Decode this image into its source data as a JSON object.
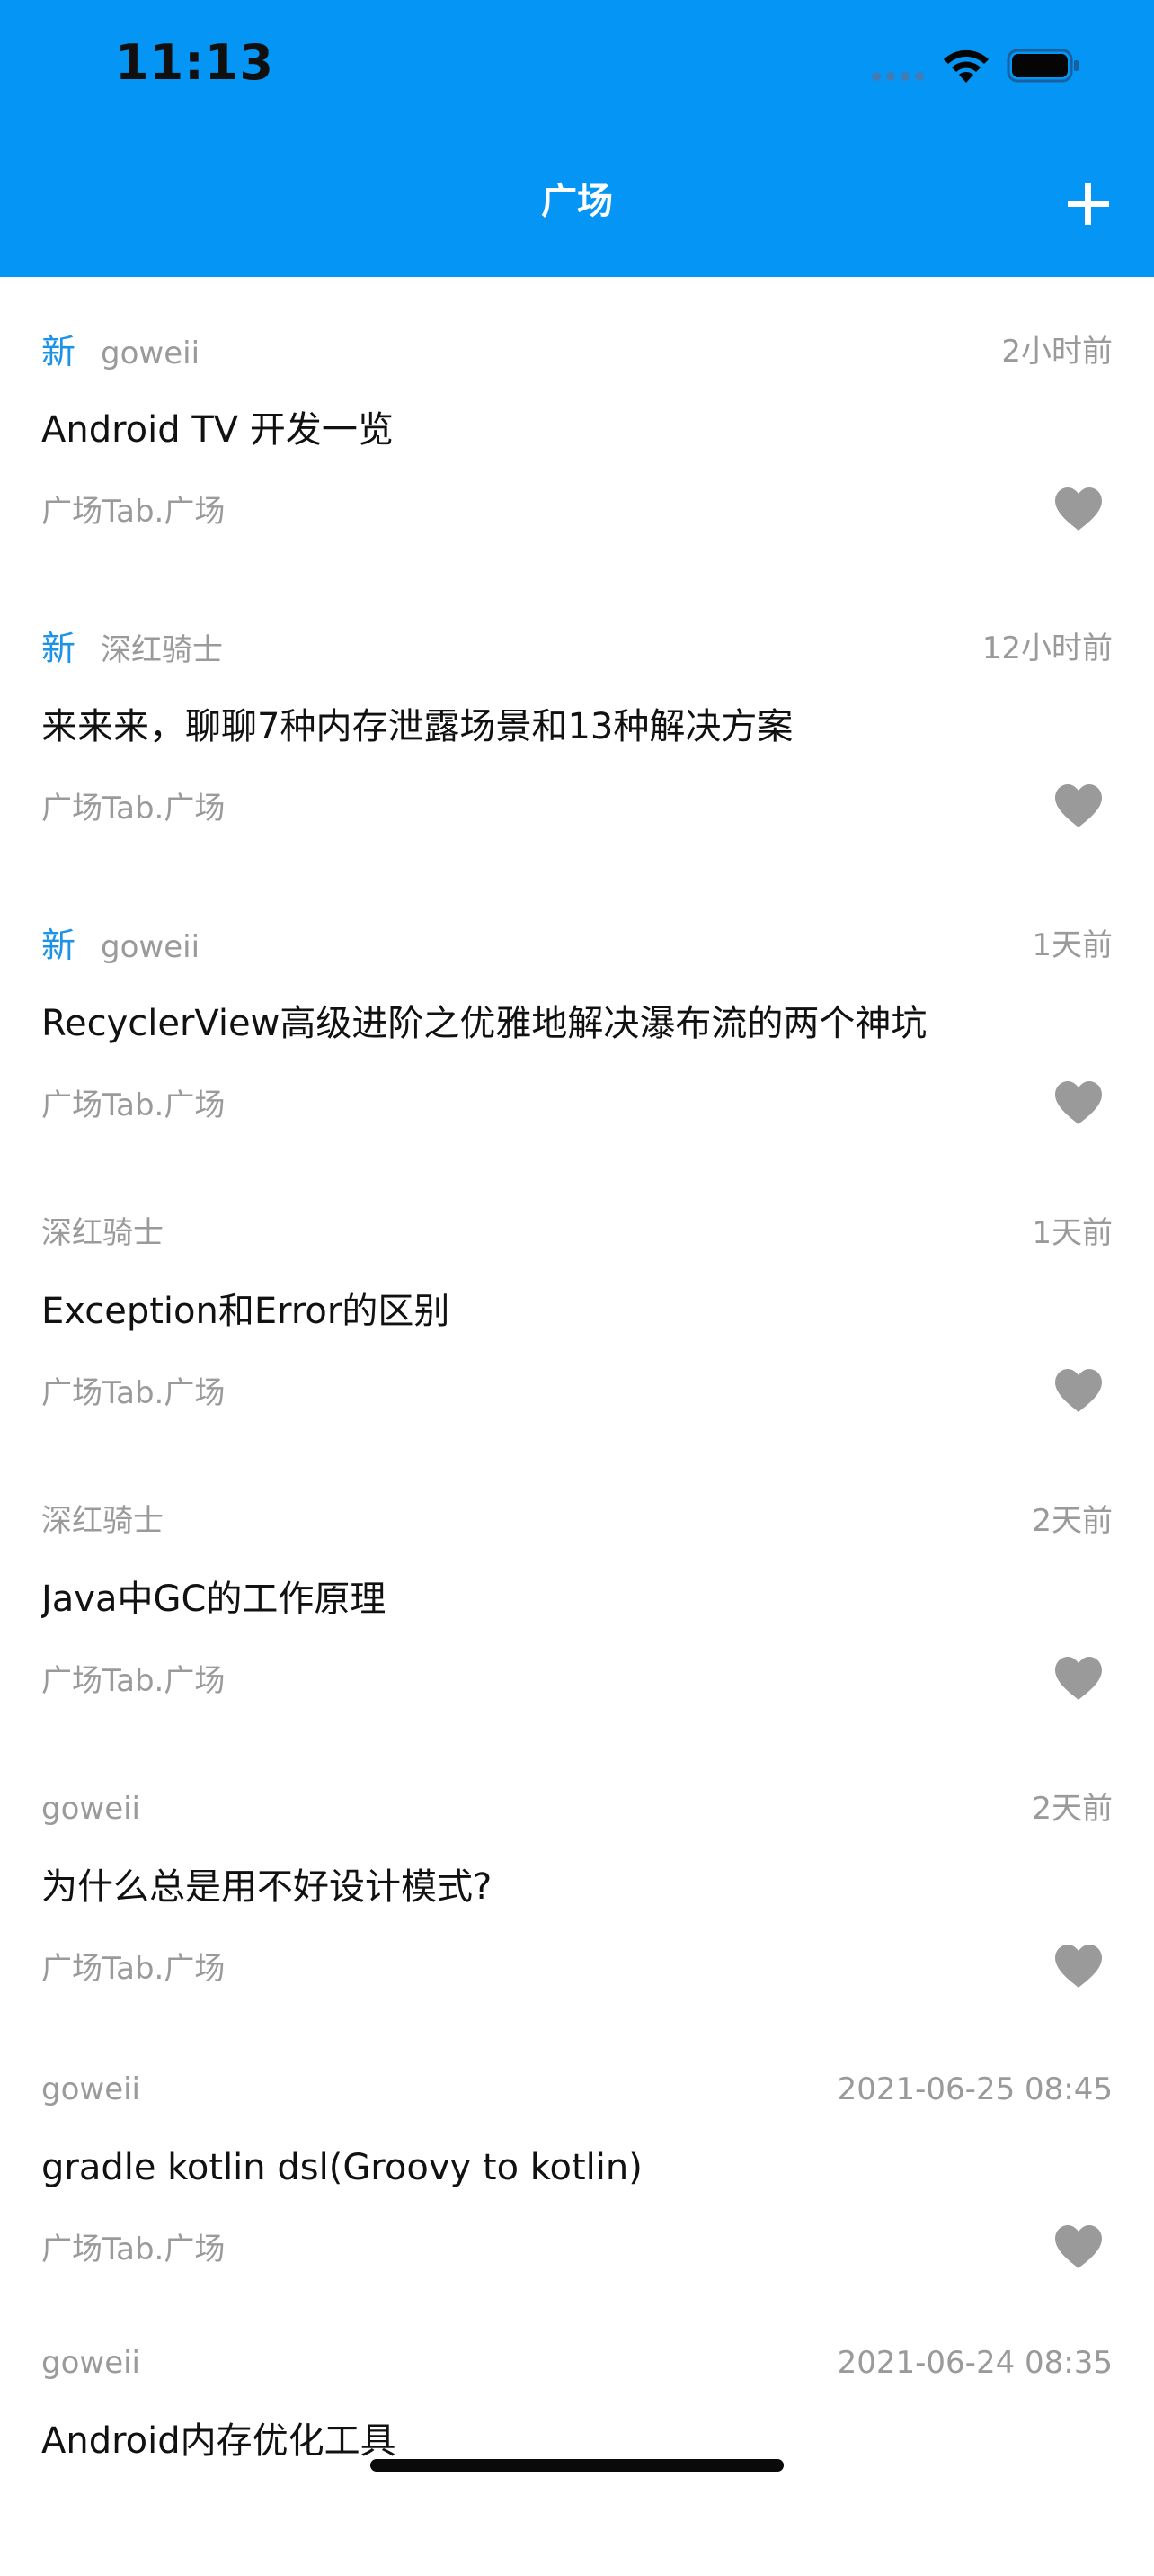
{
  "status_bar": {
    "time": "11:13"
  },
  "nav": {
    "title": "广场",
    "add_icon": "plus-icon"
  },
  "colors": {
    "header": "#0595f5",
    "new_badge": "#1c93e6",
    "meta_text": "#9a9a9a",
    "title_text": "#111111",
    "like_icon": "#9a9a9a"
  },
  "feed": {
    "items": [
      {
        "new": "新",
        "author": "goweii",
        "time": "2小时前",
        "title": "Android TV 开发一览",
        "category": "广场Tab.广场"
      },
      {
        "new": "新",
        "author": "深红骑士",
        "time": "12小时前",
        "title": "来来来，聊聊7种内存泄露场景和13种解决方案",
        "category": "广场Tab.广场"
      },
      {
        "new": "新",
        "author": "goweii",
        "time": "1天前",
        "title": "RecyclerView高级进阶之优雅地解决瀑布流的两个神坑",
        "category": "广场Tab.广场"
      },
      {
        "new": "",
        "author": "深红骑士",
        "time": "1天前",
        "title": "Exception和Error的区别",
        "category": "广场Tab.广场"
      },
      {
        "new": "",
        "author": "深红骑士",
        "time": "2天前",
        "title": "Java中GC的工作原理",
        "category": "广场Tab.广场"
      },
      {
        "new": "",
        "author": "goweii",
        "time": "2天前",
        "title": "为什么总是用不好设计模式?",
        "category": "广场Tab.广场"
      },
      {
        "new": "",
        "author": "goweii",
        "time": "2021-06-25 08:45",
        "title": "gradle kotlin dsl(Groovy to kotlin)",
        "category": "广场Tab.广场"
      },
      {
        "new": "",
        "author": "goweii",
        "time": "2021-06-24 08:35",
        "title": "Android内存优化工具",
        "category": ""
      }
    ]
  }
}
